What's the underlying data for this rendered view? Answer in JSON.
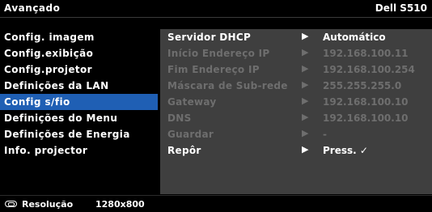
{
  "header": {
    "title": "Avançado",
    "model": "Dell S510"
  },
  "menu": {
    "items": [
      {
        "label": "Config. imagem"
      },
      {
        "label": "Config.exibição"
      },
      {
        "label": "Config.projetor"
      },
      {
        "label": "Definições da LAN"
      },
      {
        "label": "Config s/fio",
        "active": true
      },
      {
        "label": "Definições do Menu"
      },
      {
        "label": "Definições de Energia"
      },
      {
        "label": "Info. projector"
      }
    ]
  },
  "settings": {
    "rows": [
      {
        "label": "Servidor DHCP",
        "value": "Automático",
        "enabled": true
      },
      {
        "label": "Início Endereço IP",
        "value": "192.168.100.11",
        "enabled": false
      },
      {
        "label": "Fim Endereço IP",
        "value": "192.168.100.254",
        "enabled": false
      },
      {
        "label": "Máscara de Sub-rede",
        "value": "255.255.255.0",
        "enabled": false
      },
      {
        "label": "Gateway",
        "value": "192.168.100.10",
        "enabled": false
      },
      {
        "label": "DNS",
        "value": "192.168.100.10",
        "enabled": false
      },
      {
        "label": "Guardar",
        "value": "-",
        "enabled": false
      },
      {
        "label": "Repôr",
        "value": "Press.  ✓",
        "enabled": true
      }
    ],
    "arrow_glyph": "▶"
  },
  "status": {
    "icon": "display-icon",
    "label": "Resolução",
    "value": "1280x800"
  }
}
